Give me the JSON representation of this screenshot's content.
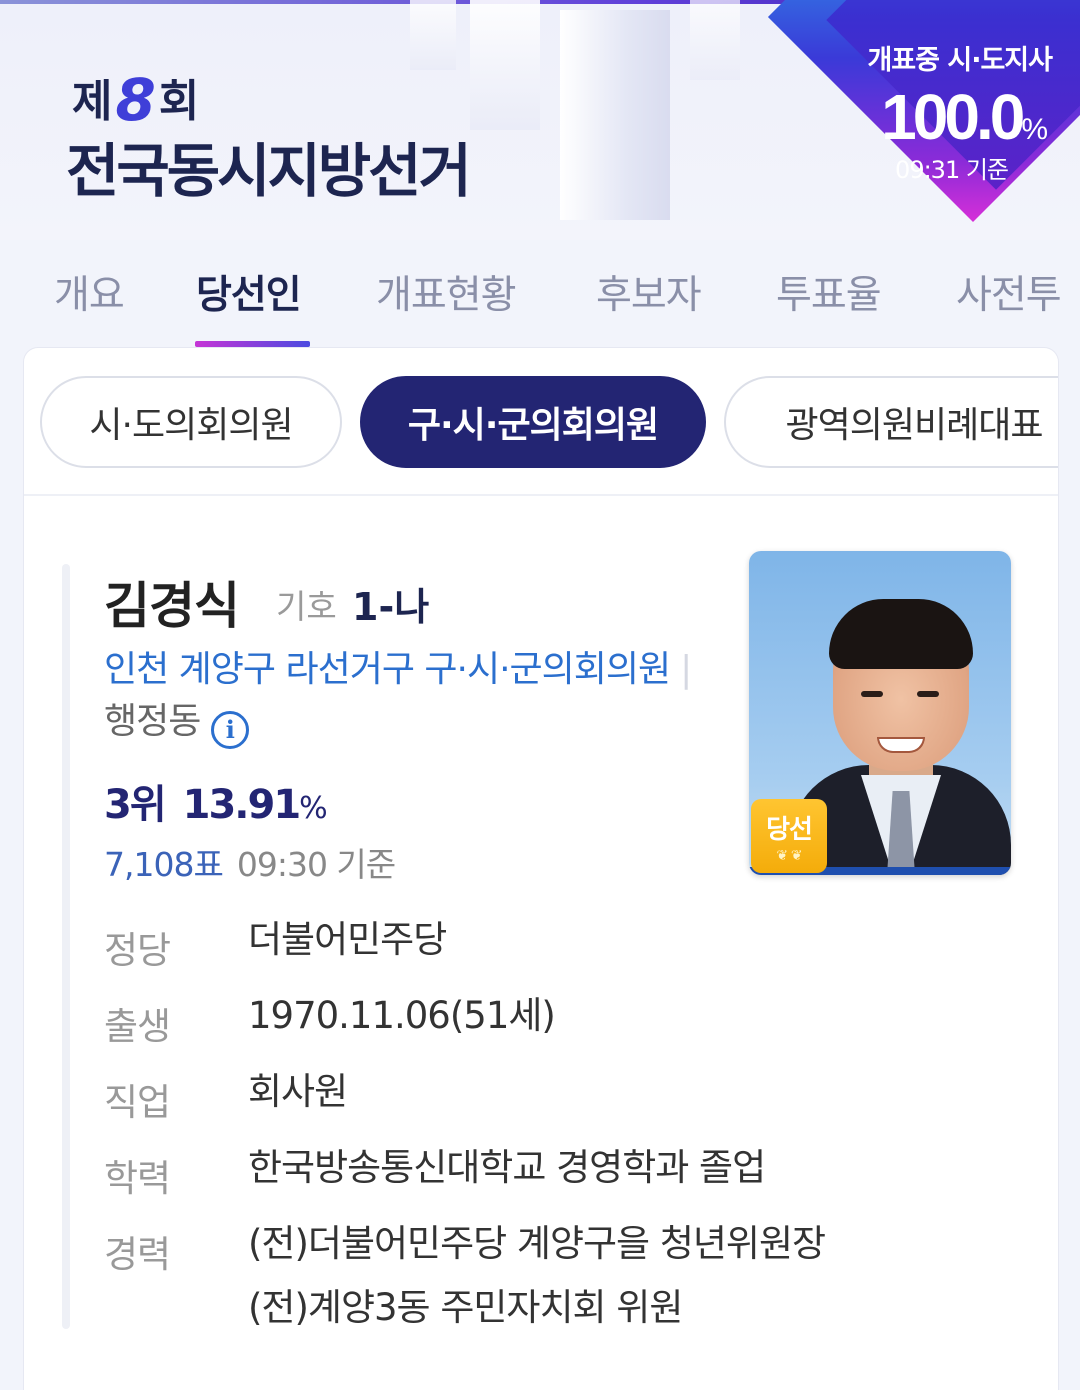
{
  "header": {
    "logo_prefix": "제",
    "logo_number": "8",
    "logo_suffix": "회",
    "logo_title": "전국동시지방선거",
    "count_label": "개표중 시·도지사",
    "count_value": "100.0",
    "count_unit": "%",
    "count_time": "09:31 기준"
  },
  "tabs": [
    "개요",
    "당선인",
    "개표현황",
    "후보자",
    "투표율",
    "사전투"
  ],
  "active_tab": "당선인",
  "chips": [
    "시·도의회의원",
    "구·시·군의회의원",
    "광역의원비례대표"
  ],
  "active_chip": "구·시·군의회의원",
  "candidate": {
    "name": "김경식",
    "symbol_label": "기호",
    "symbol": "1-나",
    "district": "인천 계양구 라선거구 구·시·군의회의원",
    "admin_link": "행정동",
    "info_icon": "i",
    "rank": "3위",
    "vote_pct": "13.91",
    "vote_pct_unit": "%",
    "votes": "7,108표",
    "vote_time": "09:30 기준",
    "badge": "당선",
    "facts": [
      {
        "label": "정당",
        "values": [
          "더불어민주당"
        ]
      },
      {
        "label": "출생",
        "values": [
          "1970.11.06(51세)"
        ]
      },
      {
        "label": "직업",
        "values": [
          "회사원"
        ]
      },
      {
        "label": "학력",
        "values": [
          "한국방송통신대학교 경영학과 졸업"
        ]
      },
      {
        "label": "경력",
        "values": [
          "(전)더불어민주당 계양구을 청년위원장",
          "(전)계양3동 주민자치회 위원"
        ]
      }
    ]
  },
  "colors": {
    "navy": "#232573",
    "link_blue": "#2b6fce",
    "badge_gold": "#f4ac0a"
  }
}
